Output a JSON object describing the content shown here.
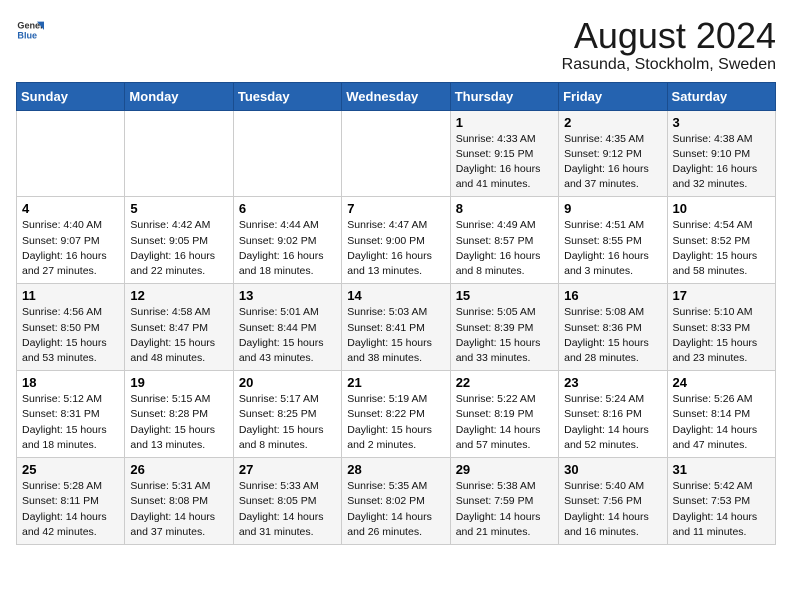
{
  "logo": {
    "line1": "General",
    "line2": "Blue"
  },
  "title": "August 2024",
  "subtitle": "Rasunda, Stockholm, Sweden",
  "days_of_week": [
    "Sunday",
    "Monday",
    "Tuesday",
    "Wednesday",
    "Thursday",
    "Friday",
    "Saturday"
  ],
  "weeks": [
    [
      {
        "day": "",
        "info": ""
      },
      {
        "day": "",
        "info": ""
      },
      {
        "day": "",
        "info": ""
      },
      {
        "day": "",
        "info": ""
      },
      {
        "day": "1",
        "info": "Sunrise: 4:33 AM\nSunset: 9:15 PM\nDaylight: 16 hours\nand 41 minutes."
      },
      {
        "day": "2",
        "info": "Sunrise: 4:35 AM\nSunset: 9:12 PM\nDaylight: 16 hours\nand 37 minutes."
      },
      {
        "day": "3",
        "info": "Sunrise: 4:38 AM\nSunset: 9:10 PM\nDaylight: 16 hours\nand 32 minutes."
      }
    ],
    [
      {
        "day": "4",
        "info": "Sunrise: 4:40 AM\nSunset: 9:07 PM\nDaylight: 16 hours\nand 27 minutes."
      },
      {
        "day": "5",
        "info": "Sunrise: 4:42 AM\nSunset: 9:05 PM\nDaylight: 16 hours\nand 22 minutes."
      },
      {
        "day": "6",
        "info": "Sunrise: 4:44 AM\nSunset: 9:02 PM\nDaylight: 16 hours\nand 18 minutes."
      },
      {
        "day": "7",
        "info": "Sunrise: 4:47 AM\nSunset: 9:00 PM\nDaylight: 16 hours\nand 13 minutes."
      },
      {
        "day": "8",
        "info": "Sunrise: 4:49 AM\nSunset: 8:57 PM\nDaylight: 16 hours\nand 8 minutes."
      },
      {
        "day": "9",
        "info": "Sunrise: 4:51 AM\nSunset: 8:55 PM\nDaylight: 16 hours\nand 3 minutes."
      },
      {
        "day": "10",
        "info": "Sunrise: 4:54 AM\nSunset: 8:52 PM\nDaylight: 15 hours\nand 58 minutes."
      }
    ],
    [
      {
        "day": "11",
        "info": "Sunrise: 4:56 AM\nSunset: 8:50 PM\nDaylight: 15 hours\nand 53 minutes."
      },
      {
        "day": "12",
        "info": "Sunrise: 4:58 AM\nSunset: 8:47 PM\nDaylight: 15 hours\nand 48 minutes."
      },
      {
        "day": "13",
        "info": "Sunrise: 5:01 AM\nSunset: 8:44 PM\nDaylight: 15 hours\nand 43 minutes."
      },
      {
        "day": "14",
        "info": "Sunrise: 5:03 AM\nSunset: 8:41 PM\nDaylight: 15 hours\nand 38 minutes."
      },
      {
        "day": "15",
        "info": "Sunrise: 5:05 AM\nSunset: 8:39 PM\nDaylight: 15 hours\nand 33 minutes."
      },
      {
        "day": "16",
        "info": "Sunrise: 5:08 AM\nSunset: 8:36 PM\nDaylight: 15 hours\nand 28 minutes."
      },
      {
        "day": "17",
        "info": "Sunrise: 5:10 AM\nSunset: 8:33 PM\nDaylight: 15 hours\nand 23 minutes."
      }
    ],
    [
      {
        "day": "18",
        "info": "Sunrise: 5:12 AM\nSunset: 8:31 PM\nDaylight: 15 hours\nand 18 minutes."
      },
      {
        "day": "19",
        "info": "Sunrise: 5:15 AM\nSunset: 8:28 PM\nDaylight: 15 hours\nand 13 minutes."
      },
      {
        "day": "20",
        "info": "Sunrise: 5:17 AM\nSunset: 8:25 PM\nDaylight: 15 hours\nand 8 minutes."
      },
      {
        "day": "21",
        "info": "Sunrise: 5:19 AM\nSunset: 8:22 PM\nDaylight: 15 hours\nand 2 minutes."
      },
      {
        "day": "22",
        "info": "Sunrise: 5:22 AM\nSunset: 8:19 PM\nDaylight: 14 hours\nand 57 minutes."
      },
      {
        "day": "23",
        "info": "Sunrise: 5:24 AM\nSunset: 8:16 PM\nDaylight: 14 hours\nand 52 minutes."
      },
      {
        "day": "24",
        "info": "Sunrise: 5:26 AM\nSunset: 8:14 PM\nDaylight: 14 hours\nand 47 minutes."
      }
    ],
    [
      {
        "day": "25",
        "info": "Sunrise: 5:28 AM\nSunset: 8:11 PM\nDaylight: 14 hours\nand 42 minutes."
      },
      {
        "day": "26",
        "info": "Sunrise: 5:31 AM\nSunset: 8:08 PM\nDaylight: 14 hours\nand 37 minutes."
      },
      {
        "day": "27",
        "info": "Sunrise: 5:33 AM\nSunset: 8:05 PM\nDaylight: 14 hours\nand 31 minutes."
      },
      {
        "day": "28",
        "info": "Sunrise: 5:35 AM\nSunset: 8:02 PM\nDaylight: 14 hours\nand 26 minutes."
      },
      {
        "day": "29",
        "info": "Sunrise: 5:38 AM\nSunset: 7:59 PM\nDaylight: 14 hours\nand 21 minutes."
      },
      {
        "day": "30",
        "info": "Sunrise: 5:40 AM\nSunset: 7:56 PM\nDaylight: 14 hours\nand 16 minutes."
      },
      {
        "day": "31",
        "info": "Sunrise: 5:42 AM\nSunset: 7:53 PM\nDaylight: 14 hours\nand 11 minutes."
      }
    ]
  ]
}
